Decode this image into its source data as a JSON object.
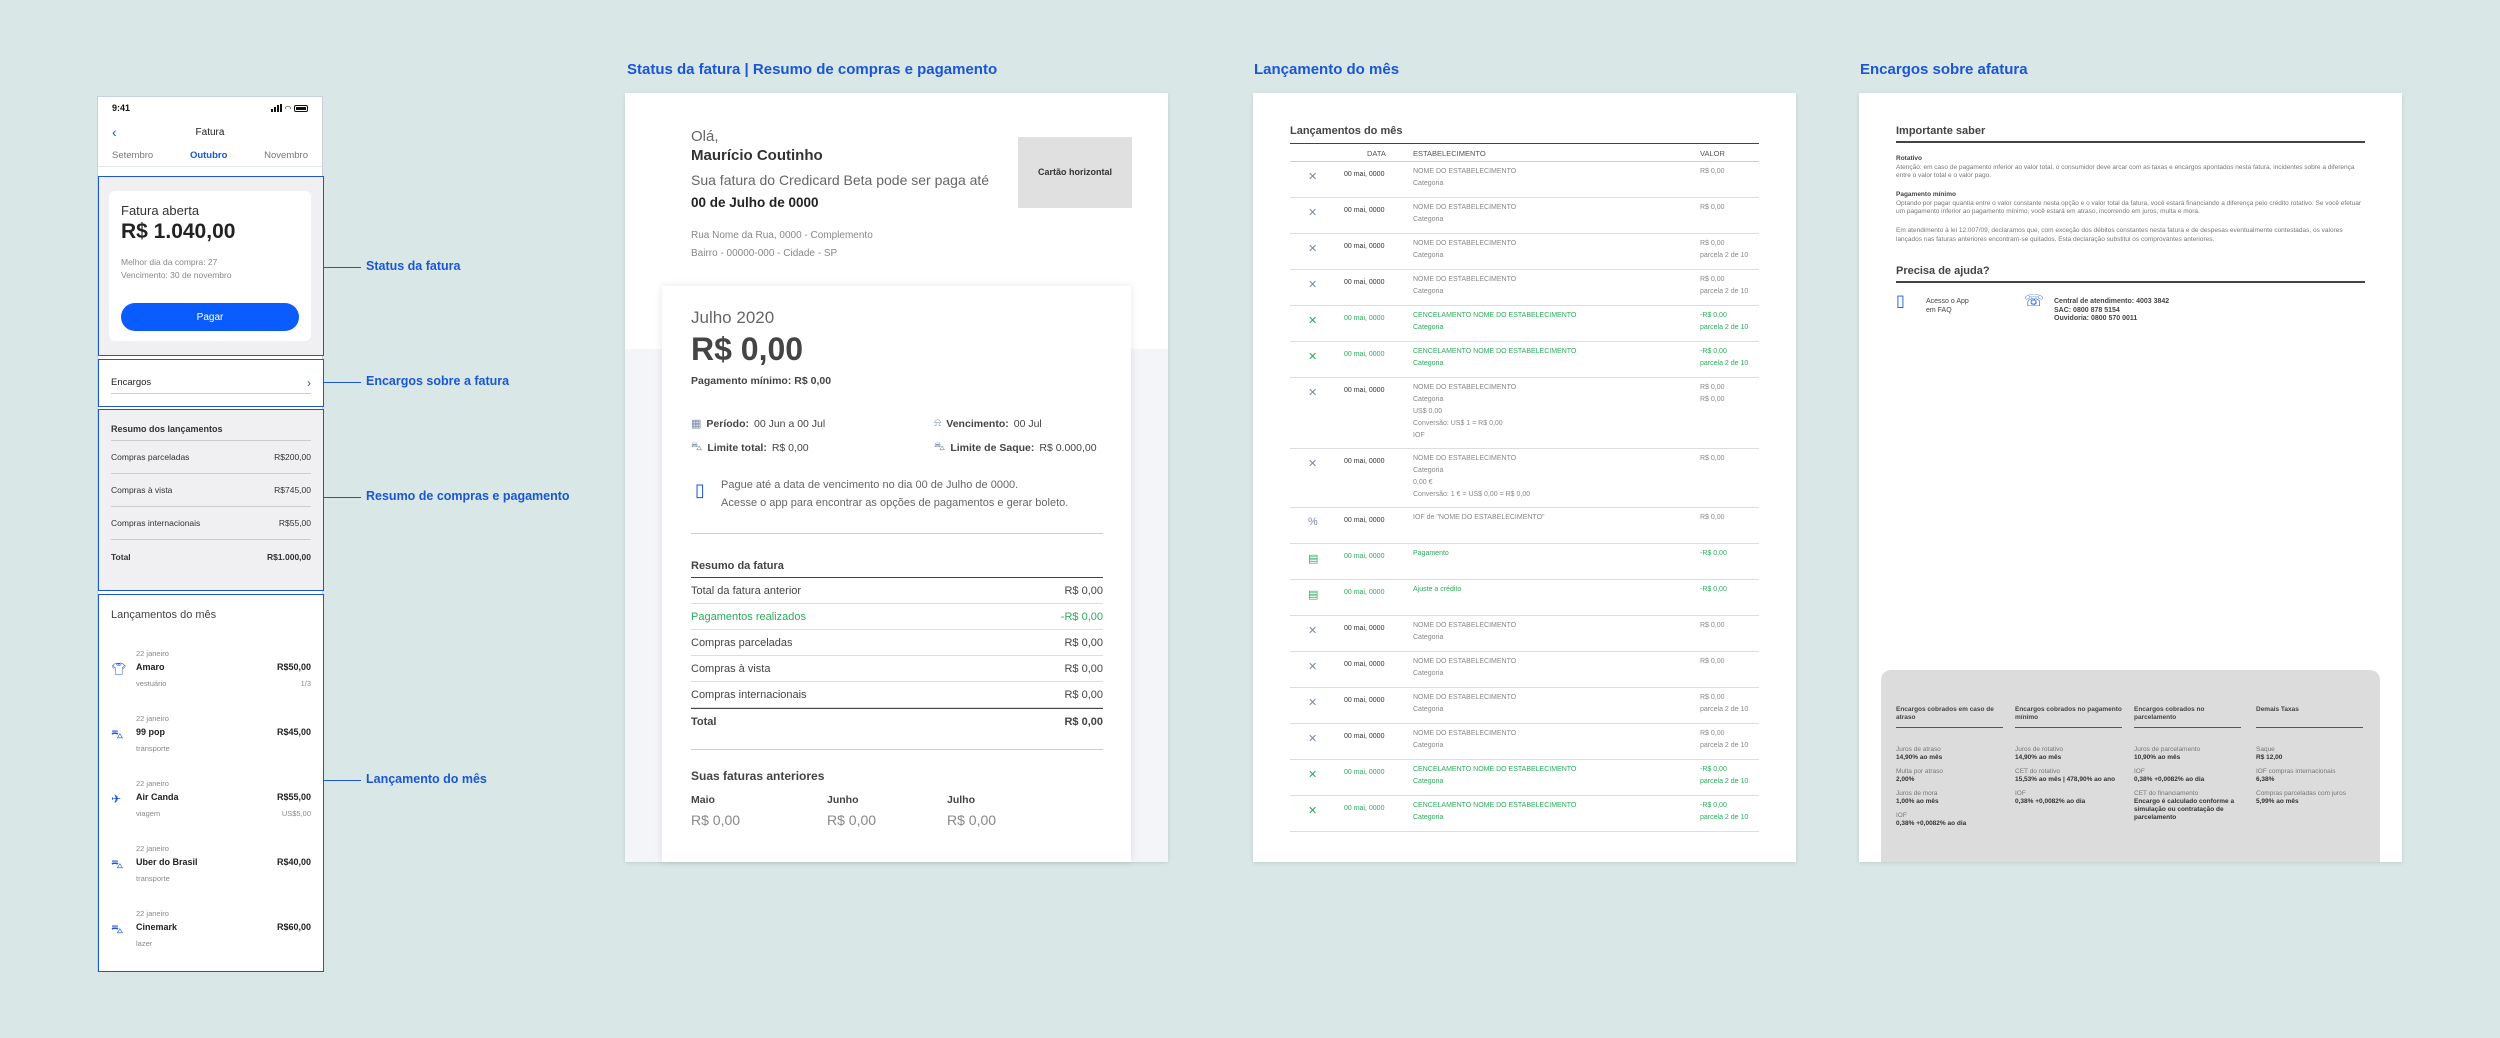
{
  "section_titles": {
    "fatura": "Status da fatura | Resumo de compras e pagamento",
    "lancamento": "Lançamento do mês",
    "encargos": "Encargos sobre afatura"
  },
  "annotations": {
    "status": "Status da fatura",
    "encargos": "Encargos sobre a fatura",
    "resumo": "Resumo de compras e pagamento",
    "lancamento": "Lançamento do mês"
  },
  "phone": {
    "time": "9:41",
    "nav_title": "Fatura",
    "tabs": [
      "Setembro",
      "Outubro",
      "Novembro"
    ],
    "card": {
      "title": "Fatura aberta",
      "amount": "R$ 1.040,00",
      "best_day": "Melhor dia da compra: 27",
      "due": "Vencimento: 30 de novembro",
      "pay_label": "Pagar"
    },
    "encargos_label": "Encargos",
    "resumo": {
      "title": "Resumo dos lançamentos",
      "rows": [
        {
          "label": "Compras parceladas",
          "value": "R$200,00"
        },
        {
          "label": "Compras à vista",
          "value": "R$745,00"
        },
        {
          "label": "Compras internacionais",
          "value": "R$55,00"
        }
      ],
      "total_label": "Total",
      "total_value": "R$1.000,00"
    },
    "lancamentos": {
      "title": "Lançamentos do mês",
      "items": [
        {
          "date": "22 janeiro",
          "name": "Amaro",
          "amount": "R$50,00",
          "category": "vestuário",
          "sub": "1/3",
          "icon": "shirt-icon"
        },
        {
          "date": "22 janeiro",
          "name": "99 pop",
          "amount": "R$45,00",
          "category": "transporte",
          "sub": "",
          "icon": "car-icon"
        },
        {
          "date": "22 janeiro",
          "name": "Air Canda",
          "amount": "R$55,00",
          "category": "viagem",
          "sub": "US$5,00",
          "icon": "plane-icon"
        },
        {
          "date": "22 janeiro",
          "name": "Uber do Brasil",
          "amount": "R$40,00",
          "category": "transporte",
          "sub": "",
          "icon": "car-icon"
        },
        {
          "date": "22 janeiro",
          "name": "Cinemark",
          "amount": "R$60,00",
          "category": "lazer",
          "sub": "",
          "icon": "ticket-icon"
        }
      ]
    }
  },
  "fatura_page": {
    "greeting": "Olá,",
    "name": "Maurício Coutinho",
    "sua_fatura": "Sua fatura do Credicard Beta  pode ser paga até",
    "due_date": "00 de Julho de 0000",
    "address_1": "Rua Nome da Rua, 0000 - Complemento",
    "address_2": "Bairro - 00000-000 - Cidade - SP",
    "card_placeholder": "Cartão horizontal",
    "month": "Julho 2020",
    "total": "R$ 0,00",
    "min_payment_label": "Pagamento mínimo:",
    "min_payment_value": "R$ 0,00",
    "periodo_label": "Período:",
    "periodo_value": "00 Jun a 00 Jul",
    "vencimento_label": "Vencimento:",
    "vencimento_value": "00 Jul",
    "limite_label": "Limite total:",
    "limite_value": "R$ 0,00",
    "saque_label": "Limite de Saque:",
    "saque_value": "R$ 0.000,00",
    "note_1": "Pague até a data de vencimento no dia 00 de Julho de 0000.",
    "note_2": "Acesse o app para encontrar as opções de pagamentos e gerar boleto.",
    "resumo_title": "Resumo da fatura",
    "resumo_rows": [
      {
        "label": "Total da fatura anterior",
        "value": "R$ 0,00"
      },
      {
        "label": "Pagamentos realizados",
        "value": "-R$ 0,00"
      },
      {
        "label": "Compras parceladas",
        "value": "R$ 0,00"
      },
      {
        "label": "Compras à vista",
        "value": "R$ 0,00"
      },
      {
        "label": "Compras internacionais",
        "value": "R$ 0,00"
      },
      {
        "label": "Total",
        "value": "R$ 0,00"
      }
    ],
    "previous_title": "Suas faturas anteriores",
    "previous": [
      {
        "month": "Maio",
        "value": "R$ 0,00"
      },
      {
        "month": "Junho",
        "value": "R$ 0,00"
      },
      {
        "month": "Julho",
        "value": "R$ 0,00"
      }
    ]
  },
  "lancamentos_page": {
    "title": "Lançamentos do mês",
    "headers": {
      "data": "DATA",
      "estabelecimento": "ESTABELECIMENTO",
      "valor": "VALOR"
    },
    "rows": [
      {
        "date": "00 mai, 0000",
        "lines": [
          "NOME DO ESTABELECIMENTO",
          "Categoria"
        ],
        "values": [
          "R$ 0,00"
        ],
        "green": false,
        "icon": "x"
      },
      {
        "date": "00 mai, 0000",
        "lines": [
          "NOME DO ESTABELECIMENTO",
          "Categoria"
        ],
        "values": [
          "R$ 0,00"
        ],
        "green": false,
        "icon": "x"
      },
      {
        "date": "00 mai, 0000",
        "lines": [
          "NOME DO ESTABELECIMENTO",
          "Categoria"
        ],
        "values": [
          "R$ 0,00",
          "parcela 2 de 10"
        ],
        "green": false,
        "icon": "x"
      },
      {
        "date": "00 mai, 0000",
        "lines": [
          "NOME DO ESTABELECIMENTO",
          "Categoria"
        ],
        "values": [
          "R$ 0,00",
          "parcela 2 de 10"
        ],
        "green": false,
        "icon": "x"
      },
      {
        "date": "00 mai, 0000",
        "lines": [
          "CENCELAMENTO NOME DO ESTABELECIMENTO",
          "Categoria"
        ],
        "values": [
          "-R$ 0,00",
          "parcela 2 de 10"
        ],
        "green": true,
        "icon": "x"
      },
      {
        "date": "00 mai, 0000",
        "lines": [
          "CENCELAMENTO NOME DO ESTABELECIMENTO",
          "Categoria"
        ],
        "values": [
          "-R$ 0,00",
          "parcela 2 de 10"
        ],
        "green": true,
        "icon": "x"
      },
      {
        "date": "00 mai, 0000",
        "lines": [
          "NOME DO ESTABELECIMENTO",
          "Categoria",
          "US$ 0,00",
          "Conversão: US$ 1 = R$ 0,00",
          "IOF"
        ],
        "values": [
          "R$ 0,00",
          "",
          "",
          "",
          "R$ 0,00"
        ],
        "green": false,
        "icon": "x"
      },
      {
        "date": "00 mai, 0000",
        "lines": [
          "NOME DO ESTABELECIMENTO",
          "Categoria",
          "0,00 €",
          "Conversão: 1 € = US$ 0,00 = R$ 0,00"
        ],
        "values": [
          "R$ 0,00"
        ],
        "green": false,
        "icon": "x"
      },
      {
        "date": "00 mai, 0000",
        "lines": [
          "IOF de \"NOME DO ESTABELECIMENTO\""
        ],
        "values": [
          "R$ 0,00"
        ],
        "green": false,
        "icon": "%"
      },
      {
        "date": "00 mai, 0000",
        "lines": [
          "Pagamento"
        ],
        "values": [
          "-R$ 0,00"
        ],
        "green": true,
        "icon": "doc"
      },
      {
        "date": "00 mai, 0000",
        "lines": [
          "Ajuste a crédito"
        ],
        "values": [
          "-R$ 0,00"
        ],
        "green": true,
        "icon": "doc"
      },
      {
        "date": "00 mai, 0000",
        "lines": [
          "NOME DO ESTABELECIMENTO",
          "Categoria"
        ],
        "values": [
          "R$ 0,00"
        ],
        "green": false,
        "icon": "x"
      },
      {
        "date": "00 mai, 0000",
        "lines": [
          "NOME DO ESTABELECIMENTO",
          "Categoria"
        ],
        "values": [
          "R$ 0,00"
        ],
        "green": false,
        "icon": "x"
      },
      {
        "date": "00 mai, 0000",
        "lines": [
          "NOME DO ESTABELECIMENTO",
          "Categoria"
        ],
        "values": [
          "R$ 0,00",
          "parcela 2 de 10"
        ],
        "green": false,
        "icon": "x"
      },
      {
        "date": "00 mai, 0000",
        "lines": [
          "NOME DO ESTABELECIMENTO",
          "Categoria"
        ],
        "values": [
          "R$ 0,00",
          "parcela 2 de 10"
        ],
        "green": false,
        "icon": "x"
      },
      {
        "date": "00 mai, 0000",
        "lines": [
          "CENCELAMENTO NOME DO ESTABELECIMENTO",
          "Categoria"
        ],
        "values": [
          "-R$ 0,00",
          "parcela 2 de 10"
        ],
        "green": true,
        "icon": "x"
      },
      {
        "date": "00 mai, 0000",
        "lines": [
          "CENCELAMENTO NOME DO ESTABELECIMENTO",
          "Categoria"
        ],
        "values": [
          "-R$ 0,00",
          "parcela 2 de 10"
        ],
        "green": true,
        "icon": "x"
      }
    ]
  },
  "encargos_page": {
    "importante_title": "Importante saber",
    "rotativo_title": "Rotativo",
    "rotativo_text": "Atenção: em caso de pagamento inferior ao valor total, o consumidor deve arcar com as taxas e encargos apontados nesta fatura, incidentes sobre a diferença entre o valor total e o valor pago.",
    "minimo_title": "Pagamento mínimo",
    "minimo_text": "Optando por pagar quantia entre o valor constante nesta opção e o valor total da fatura, você estará financiando a diferença pelo crédito rotativo. Se você efetuar um pagamento inferior ao pagamento mínimo, você estará em atraso, incorrendo em juros, multa e mora.",
    "atendimento_text": "Em atendimento à lei 12.007/09, declaramos que, com exceção dos débitos constantes nesta fatura e de despesas eventualmente contestadas, os valores lançados nas faturas anteriores encontram-se quitados. Esta declaração substitui os comprovantes anteriores.",
    "ajuda_title": "Precisa de ajuda?",
    "ajuda_app": "Acesso o App em FAQ",
    "central": "Central de atendimento: 4003 3842",
    "sac": "SAC: 0800 878 5154",
    "ouvidoria": "Ouvidoria: 0800 570 0011",
    "columns": [
      {
        "title": "Encargos cobrados em caso de atraso",
        "items": [
          [
            "Juros de atraso",
            "14,90% ao mês"
          ],
          [
            "Multa por atraso",
            "2,00%"
          ],
          [
            "Juros de mora",
            "1,00% ao mês"
          ],
          [
            "IOF",
            "0,38% +0,0082% ao dia"
          ]
        ]
      },
      {
        "title": "Encargos cobrados no pagamento mínimo",
        "items": [
          [
            "Juros de rotativo",
            "14,90% ao mês"
          ],
          [
            "CET do rotativo",
            "15,53% ao mês | 478,90% ao ano"
          ],
          [
            "IOF",
            "0,38% +0,0082% ao dia"
          ]
        ]
      },
      {
        "title": "Encargos cobrados no parcelamento",
        "items": [
          [
            "Juros de parcelamento",
            "10,90% ao mês"
          ],
          [
            "IOF",
            "0,38% +0,0082% ao dia"
          ],
          [
            "CET do financiamento",
            "Encargo é calculado conforme a simulação ou contratação de parcelamento"
          ]
        ]
      },
      {
        "title": "Demais Taxas",
        "items": [
          [
            "Saque",
            "R$ 12,00"
          ],
          [
            "IOF compras internacionais",
            "6,38%"
          ],
          [
            "Compras parceladas com juros",
            "5,99% ao mês"
          ]
        ]
      }
    ]
  }
}
